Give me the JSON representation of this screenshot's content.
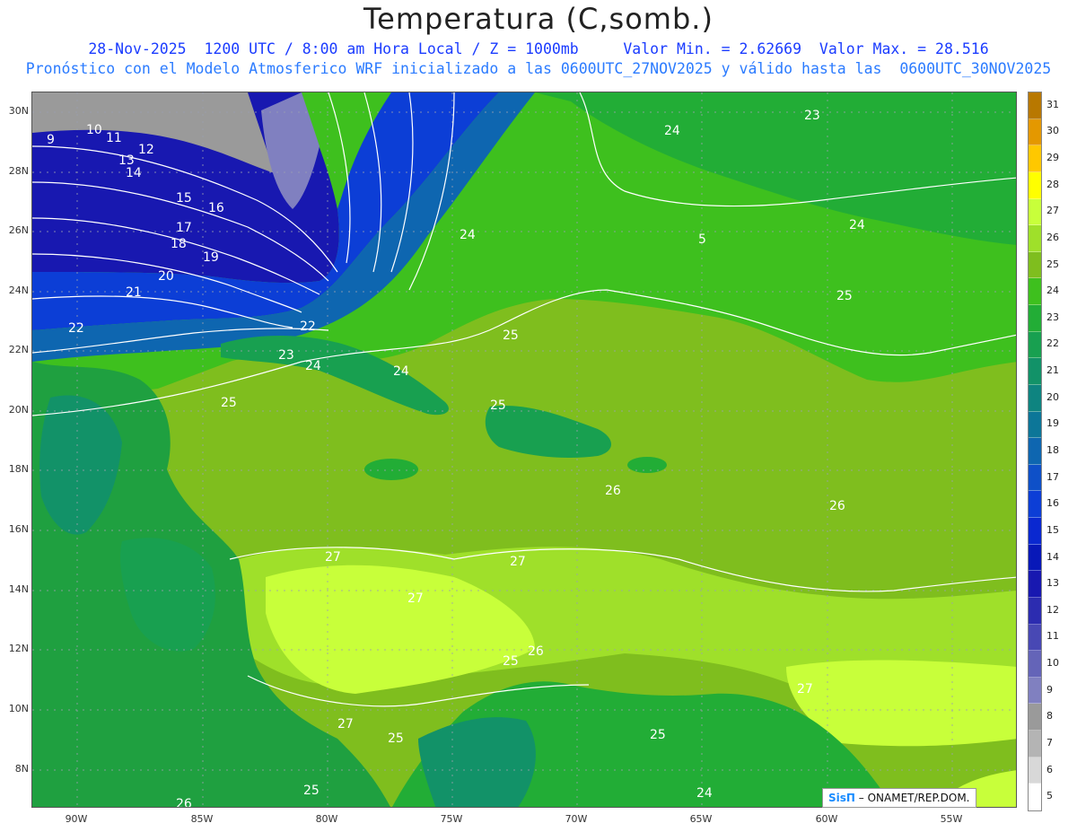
{
  "header": {
    "title": "Temperatura (C,somb.)",
    "info_line": "28-Nov-2025  1200 UTC / 8:00 am Hora Local / Z = 1000mb     Valor Min. = 2.62669  Valor Max. = 28.516",
    "model_line": "Pronóstico con el Modelo Atmosferico WRF inicializado a las 0600UTC_27NOV2025 y válido hasta las  0600UTC_30NOV2025"
  },
  "axes": {
    "lat_labels": [
      "30N",
      "28N",
      "26N",
      "24N",
      "22N",
      "20N",
      "18N",
      "16N",
      "14N",
      "12N",
      "10N",
      "8N"
    ],
    "lon_labels": [
      "90W",
      "85W",
      "80W",
      "75W",
      "70W",
      "65W",
      "60W",
      "55W"
    ]
  },
  "legend": {
    "labels": [
      "31",
      "30",
      "29",
      "28",
      "27",
      "26",
      "25",
      "24",
      "23",
      "22",
      "21",
      "20",
      "19",
      "18",
      "17",
      "16",
      "15",
      "14",
      "13",
      "12",
      "11",
      "10",
      "9",
      "8",
      "7",
      "6",
      "5"
    ],
    "colors": [
      "#b87800",
      "#e49800",
      "#ffc800",
      "#ffff00",
      "#c8ff3a",
      "#9fe02a",
      "#7fbe1e",
      "#3ec01e",
      "#22ad36",
      "#18a050",
      "#129268",
      "#0e8480",
      "#0c7698",
      "#0e66b0",
      "#0e50c8",
      "#0c3ed6",
      "#0a28d0",
      "#0818b8",
      "#1818b0",
      "#2c2cb0",
      "#4848b4",
      "#6464b8",
      "#8080c0",
      "#9a9a9a",
      "#b4b4b4",
      "#d8d8d8",
      "#ffffff"
    ]
  },
  "map": {
    "contour_labels": [
      "9",
      "10",
      "11",
      "12",
      "13",
      "14",
      "15",
      "16",
      "17",
      "18",
      "19",
      "20",
      "21",
      "22",
      "22",
      "23",
      "24",
      "24",
      "24",
      "24",
      "24",
      "24",
      "25",
      "25",
      "25",
      "25",
      "25",
      "25",
      "25",
      "25",
      "26",
      "26",
      "26",
      "26",
      "27",
      "27",
      "27",
      "27",
      "27",
      "23",
      "5"
    ],
    "land_color": "#1fa040",
    "ocean_colors": [
      "#7fbe1e",
      "#9fe02a",
      "#c8ff3a",
      "#3ec01e"
    ]
  },
  "credit": {
    "logo": "SisΠ",
    "text": "– ONAMET/REP.DOM."
  }
}
